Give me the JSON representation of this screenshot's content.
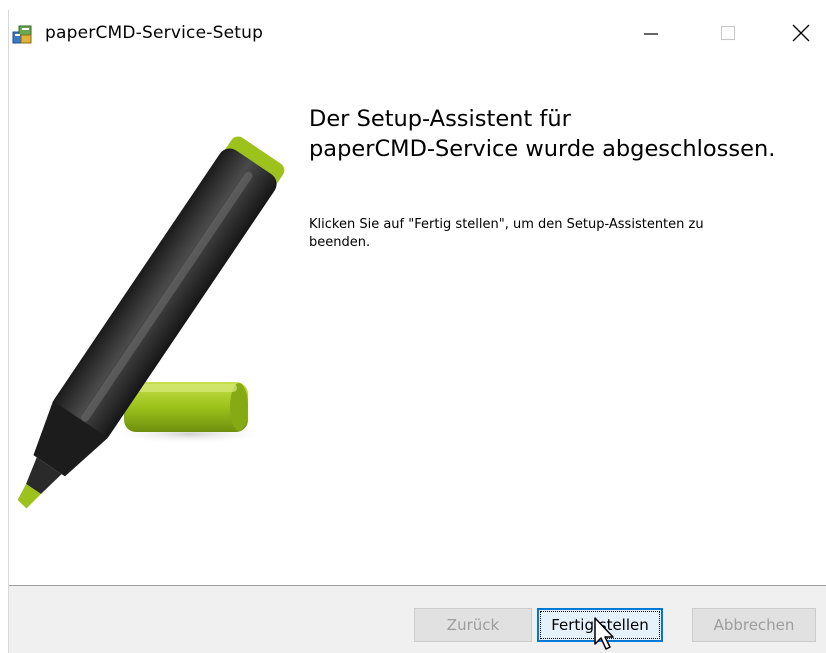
{
  "window": {
    "title": "paperCMD-Service-Setup",
    "controls": {
      "minimize": "minimize-icon",
      "maximize": "maximize-icon",
      "close": "close-icon"
    }
  },
  "content": {
    "heading_line1": "Der Setup-Assistent für",
    "heading_line2": "paperCMD-Service wurde abgeschlossen.",
    "body_line1": "Klicken Sie auf \"Fertig stellen\", um den Setup-Assistenten zu",
    "body_line2": "beenden.",
    "illustration": "highlighter-marker-image"
  },
  "footer": {
    "back_label": "Zurück",
    "finish_label": "Fertig stellen",
    "cancel_label": "Abbrechen"
  },
  "colors": {
    "accent": "#0078d7",
    "marker_green": "#9cc21b",
    "marker_body": "#2b2b2b",
    "footer_bg": "#f0f0f0"
  }
}
